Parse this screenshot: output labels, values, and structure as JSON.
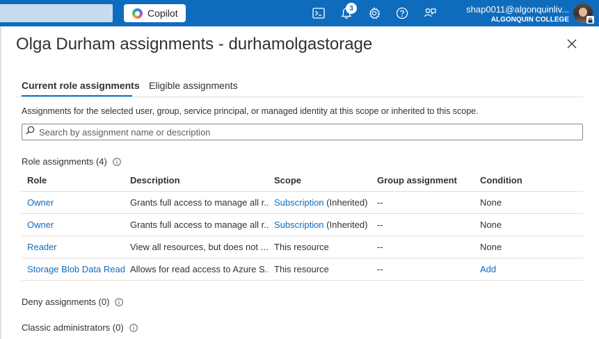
{
  "topbar": {
    "copilot_label": "Copilot",
    "notifications_count": "3",
    "user_email": "shap0011@algonquinliv...",
    "user_org": "ALGONQUIN COLLEGE",
    "icons": [
      "cloud-shell-icon",
      "notifications-icon",
      "settings-icon",
      "help-icon",
      "feedback-icon"
    ]
  },
  "blade": {
    "title": "Olga Durham assignments - durhamolgastorage",
    "tabs": [
      {
        "label": "Current role assignments",
        "active": true
      },
      {
        "label": "Eligible assignments",
        "active": false
      }
    ],
    "description": "Assignments for the selected user, group, service principal, or managed identity at this scope or inherited to this scope.",
    "search_placeholder": "Search by assignment name or description",
    "role_assignments_label": "Role assignments (4)",
    "deny_assignments_label": "Deny assignments (0)",
    "classic_admins_label": "Classic administrators (0)"
  },
  "table": {
    "headers": [
      "Role",
      "Description",
      "Scope",
      "Group assignment",
      "Condition"
    ],
    "rows": [
      {
        "role": "Owner",
        "description": "Grants full access to manage all r...",
        "scope": "Subscription",
        "scope_suffix": "(Inherited)",
        "group": "--",
        "condition": "None"
      },
      {
        "role": "Owner",
        "description": "Grants full access to manage all r...",
        "scope": "Subscription",
        "scope_suffix": "(Inherited)",
        "group": "--",
        "condition": "None"
      },
      {
        "role": "Reader",
        "description": "View all resources, but does not ...",
        "scope": "This resource",
        "scope_suffix": "",
        "group": "--",
        "condition": "None"
      },
      {
        "role": "Storage Blob Data Reader",
        "description": "Allows for read access to Azure S...",
        "scope": "This resource",
        "scope_suffix": "",
        "group": "--",
        "condition": "Add"
      }
    ]
  },
  "colors": {
    "topbar": "#0f6cbd",
    "link": "#0f6cbd",
    "tab_underline": "#0078d4",
    "text": "#323130"
  }
}
